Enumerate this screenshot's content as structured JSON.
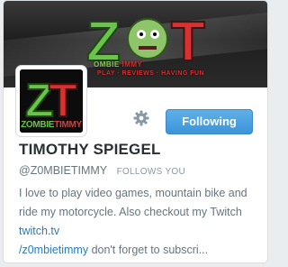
{
  "banner": {
    "logo_text": "Z0T",
    "tagline_parts": [
      "OMBIE",
      "IMMY",
      "PLAY · REVIEWS · HAVING FUN"
    ]
  },
  "avatar": {
    "label_green": "ZOMBIE",
    "label_red": "TIMMY"
  },
  "actions": {
    "follow_label": "Following"
  },
  "profile": {
    "name": "TIMOTHY SPIEGEL",
    "handle": "@Z0MBIETIMMY",
    "follows_you": "FOLLOWS YOU",
    "bio": {
      "part1": "I love to play video games, mountain bike and ride my motorcycle. Also checkout my Twitch ",
      "link1": "twitch.tv",
      "link2": "/z0mbietimmy",
      "part2": " don't forget to subscri..."
    }
  },
  "colors": {
    "follow_button": "#3b94d9",
    "link": "#2b7bb9",
    "brand_green": "#6cc34a",
    "brand_red": "#e03a3a"
  },
  "icons": {
    "settings": "gear-icon"
  }
}
